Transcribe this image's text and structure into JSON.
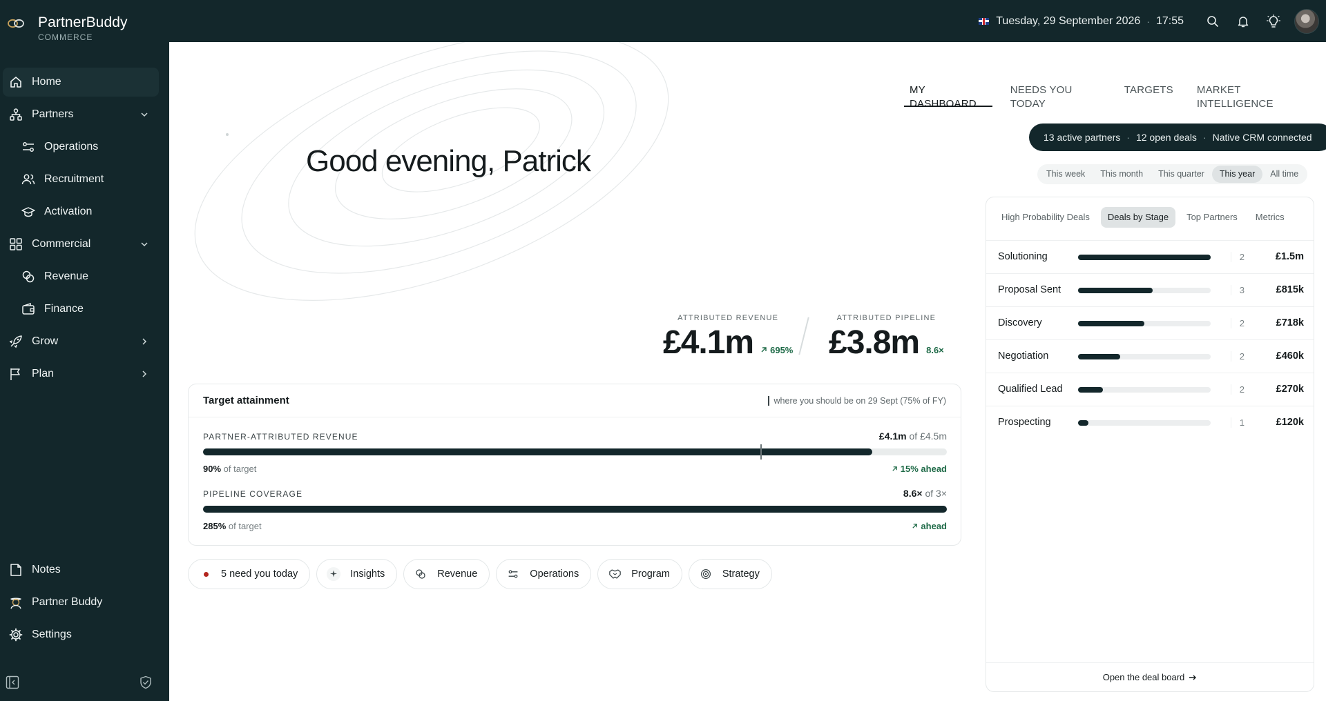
{
  "app": {
    "name": "PartnerBuddy",
    "subtitle": "COMMERCE",
    "date": "Tuesday, 29 September 2026",
    "separator": "·",
    "time": "17:55"
  },
  "sidebar": {
    "items": [
      {
        "label": "Home",
        "icon": "home-icon"
      },
      {
        "label": "Partners",
        "icon": "partners-icon"
      },
      {
        "label": "Operations",
        "icon": "operations-icon"
      },
      {
        "label": "Recruitment",
        "icon": "recruitment-icon"
      },
      {
        "label": "Activation",
        "icon": "activation-icon"
      },
      {
        "label": "Commercial",
        "icon": "commercial-icon"
      },
      {
        "label": "Revenue",
        "icon": "revenue-icon"
      },
      {
        "label": "Finance",
        "icon": "finance-icon"
      },
      {
        "label": "Grow",
        "icon": "rocket-icon"
      },
      {
        "label": "Plan",
        "icon": "flag-icon"
      },
      {
        "label": "Notes",
        "icon": "notes-icon"
      },
      {
        "label": "Partner Buddy",
        "icon": "buddy-icon"
      },
      {
        "label": "Settings",
        "icon": "gear-icon"
      }
    ]
  },
  "main": {
    "greeting": "Good evening, Patrick",
    "tabs": [
      "MY DASHBOARD",
      "NEEDS YOU TODAY",
      "TARGETS",
      "MARKET INTELLIGENCE"
    ],
    "status": {
      "active_partners": "13 active partners",
      "open_deals": "12 open deals",
      "crm": "Native CRM connected",
      "dot": "·"
    },
    "periods": [
      "This week",
      "This month",
      "This quarter",
      "This year",
      "All time"
    ],
    "kpis": {
      "revenue": {
        "label": "ATTRIBUTED REVENUE",
        "value": "£4.1m",
        "delta": "695%"
      },
      "pipeline": {
        "label": "ATTRIBUTED PIPELINE",
        "value": "£3.8m",
        "delta": "8.6×"
      }
    },
    "target": {
      "title": "Target attainment",
      "legend": "where you should be on 29 Sept (75% of FY)",
      "of_word": "of",
      "of_target": "of target",
      "metrics": [
        {
          "label": "PARTNER-ATTRIBUTED REVENUE",
          "current": "£4.1m",
          "target": "£4.5m",
          "pct": "90%",
          "ahead": "15% ahead",
          "fill": 0.9,
          "expected": 0.75
        },
        {
          "label": "PIPELINE COVERAGE",
          "current": "8.6×",
          "target": "3×",
          "pct": "285%",
          "ahead": "ahead",
          "fill": 1.0
        }
      ]
    },
    "chips": [
      {
        "label": "5 need you today",
        "icon": "alert-dot"
      },
      {
        "label": "Insights",
        "icon": "sparkle-icon"
      },
      {
        "label": "Revenue",
        "icon": "coins-icon"
      },
      {
        "label": "Operations",
        "icon": "sliders-icon"
      },
      {
        "label": "Program",
        "icon": "handshake-icon"
      },
      {
        "label": "Strategy",
        "icon": "target-icon"
      }
    ]
  },
  "deals": {
    "tabs": [
      "High Probability Deals",
      "Deals by Stage",
      "Top Partners",
      "Metrics"
    ],
    "rows": [
      {
        "stage": "Solutioning",
        "count": "2",
        "amount": "£1.5m",
        "share": 1.0
      },
      {
        "stage": "Proposal Sent",
        "count": "3",
        "amount": "£815k",
        "share": 0.56
      },
      {
        "stage": "Discovery",
        "count": "2",
        "amount": "£718k",
        "share": 0.5
      },
      {
        "stage": "Negotiation",
        "count": "2",
        "amount": "£460k",
        "share": 0.32
      },
      {
        "stage": "Qualified Lead",
        "count": "2",
        "amount": "£270k",
        "share": 0.19
      },
      {
        "stage": "Prospecting",
        "count": "1",
        "amount": "£120k",
        "share": 0.08
      }
    ],
    "footer": "Open the deal board"
  },
  "colors": {
    "dark": "#13272b",
    "accent_green": "#1e6a47",
    "alert_red": "#b3261e"
  }
}
